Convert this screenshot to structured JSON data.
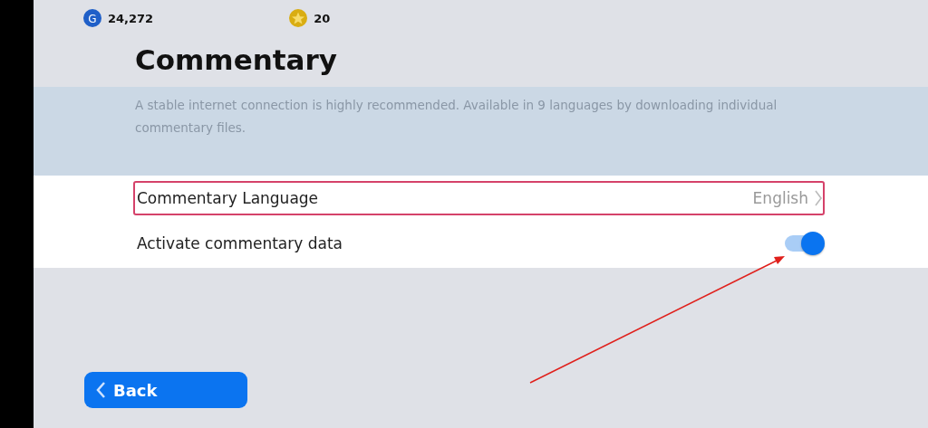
{
  "currencies": [
    {
      "kind": "g",
      "icon_text": "G",
      "amount": "24,272"
    },
    {
      "kind": "star",
      "amount": "20"
    }
  ],
  "title": "Commentary",
  "description": "A stable internet connection is highly recommended. Available in 9 languages by downloading individual commentary files.",
  "settings": [
    {
      "kind": "select",
      "label": "Commentary Language",
      "value": "English",
      "highlighted": true
    },
    {
      "kind": "toggle",
      "label": "Activate commentary data",
      "on": true,
      "highlighted": false
    }
  ],
  "back_button": {
    "label": "Back"
  }
}
